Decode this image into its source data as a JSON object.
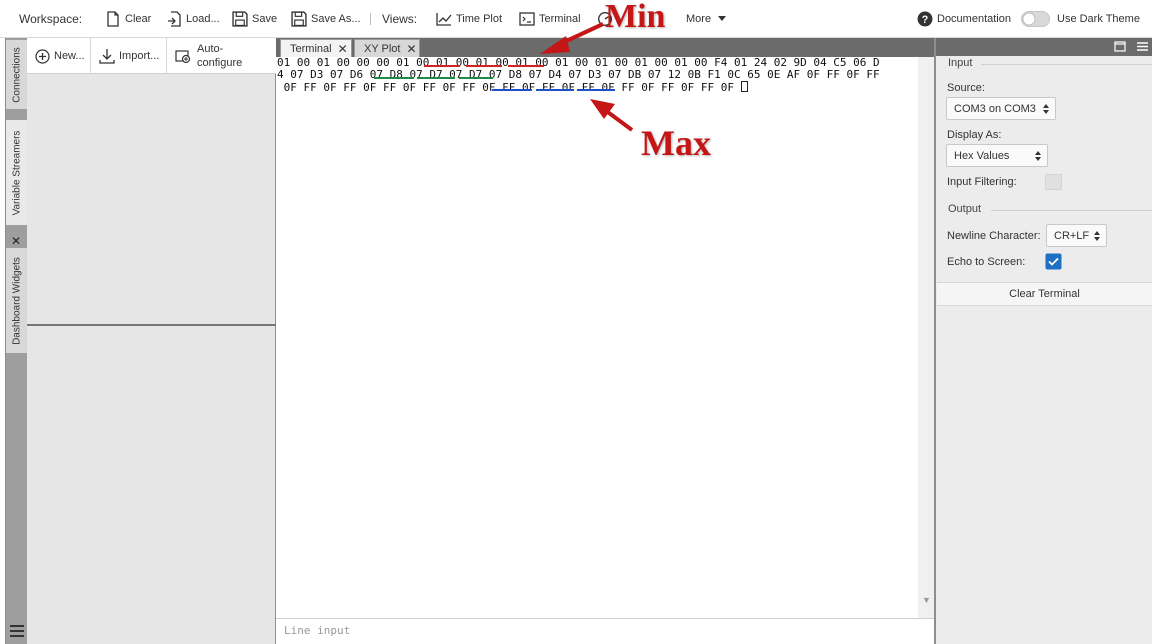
{
  "toolbar": {
    "workspace_label": "Workspace:",
    "clear": "Clear",
    "load": "Load...",
    "save": "Save",
    "save_as": "Save As...",
    "views_label": "Views:",
    "time_plot": "Time Plot",
    "terminal": "Terminal",
    "more": "More",
    "documentation": "Documentation",
    "dark_theme": "Use Dark Theme"
  },
  "rail": {
    "tabs": [
      "Connections",
      "Variable Streamers",
      "Dashboard Widgets"
    ]
  },
  "left_panel": {
    "new": "New...",
    "import": "Import...",
    "auto_line1": "Auto-",
    "auto_line2": "configure"
  },
  "tabs": [
    {
      "label": "Terminal",
      "active": true
    },
    {
      "label": "XY Plot",
      "active": false
    }
  ],
  "terminal": {
    "lines": [
      "01 00 01 00 00 00 01 00 01 00 01 00 01 00 01 00 01 00 01 00 01 00 F4 01 24 02 9D 04 C5 06 D",
      "4 07 D3 07 D6 07 D8 07 D7 07 D7 07 D8 07 D4 07 D3 07 DB 07 12 0B F1 0C 65 0E AF 0F FF 0F FF",
      " 0F FF 0F FF 0F FF 0F FF 0F FF 0F FF 0F FF 0F FF 0F FF 0F FF 0F FF 0F "
    ],
    "line_input_placeholder": "Line input"
  },
  "annotations": {
    "min_label": "Min",
    "max_label": "Max",
    "colors": {
      "min": "#d32222",
      "mid": "#1a8a44",
      "max": "#1e50c8"
    }
  },
  "right_panel": {
    "input_section": "Input",
    "source_label": "Source:",
    "source_value": "COM3 on COM3",
    "display_as_label": "Display As:",
    "display_as_value": "Hex Values",
    "input_filtering_label": "Input Filtering:",
    "output_section": "Output",
    "newline_label": "Newline Character:",
    "newline_value": "CR+LF",
    "echo_label": "Echo to Screen:",
    "echo_checked": true,
    "clear_terminal": "Clear Terminal"
  }
}
